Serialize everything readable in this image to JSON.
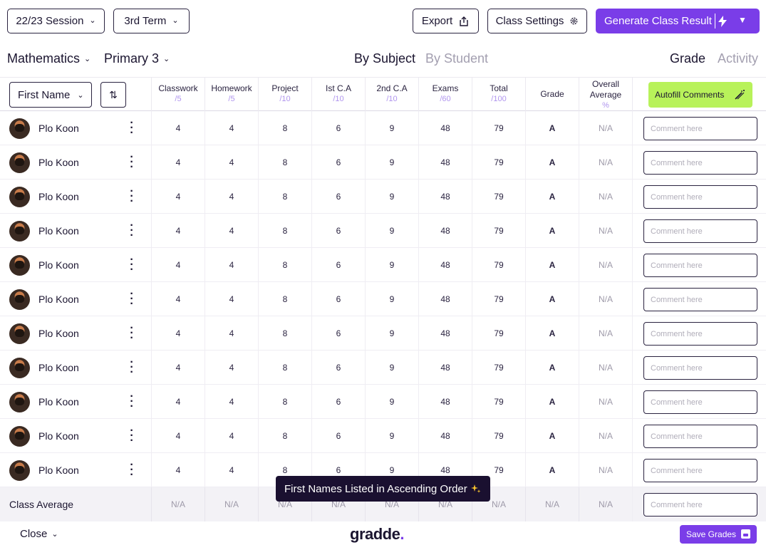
{
  "topbar": {
    "session": "22/23 Session",
    "term": "3rd Term",
    "export_label": "Export",
    "class_settings_label": "Class Settings",
    "generate_label": "Generate Class Result"
  },
  "subbar": {
    "subject": "Mathematics",
    "class": "Primary 3",
    "view_tabs": [
      "By Subject",
      "By Student"
    ],
    "active_view": "By Subject",
    "mode_tabs": [
      "Grade",
      "Activity"
    ],
    "active_mode": "Grade"
  },
  "table": {
    "sort_field": "First Name",
    "columns": [
      {
        "label": "Classwork",
        "max": "/5"
      },
      {
        "label": "Homework",
        "max": "/5"
      },
      {
        "label": "Project",
        "max": "/10"
      },
      {
        "label": "Ist C.A",
        "max": "/10"
      },
      {
        "label": "2nd C.A",
        "max": "/10"
      },
      {
        "label": "Exams",
        "max": "/60"
      },
      {
        "label": "Total",
        "max": "/100"
      },
      {
        "label": "Grade",
        "max": ""
      },
      {
        "label": "Overall Average",
        "max": "%"
      }
    ],
    "autofill_label": "Autofill Comments",
    "comment_placeholder": "Comment here",
    "rows": [
      {
        "name": "Plo Koon",
        "values": [
          "4",
          "4",
          "8",
          "6",
          "9",
          "48",
          "79",
          "A",
          "N/A"
        ]
      },
      {
        "name": "Plo Koon",
        "values": [
          "4",
          "4",
          "8",
          "6",
          "9",
          "48",
          "79",
          "A",
          "N/A"
        ]
      },
      {
        "name": "Plo Koon",
        "values": [
          "4",
          "4",
          "8",
          "6",
          "9",
          "48",
          "79",
          "A",
          "N/A"
        ]
      },
      {
        "name": "Plo Koon",
        "values": [
          "4",
          "4",
          "8",
          "6",
          "9",
          "48",
          "79",
          "A",
          "N/A"
        ]
      },
      {
        "name": "Plo Koon",
        "values": [
          "4",
          "4",
          "8",
          "6",
          "9",
          "48",
          "79",
          "A",
          "N/A"
        ]
      },
      {
        "name": "Plo Koon",
        "values": [
          "4",
          "4",
          "8",
          "6",
          "9",
          "48",
          "79",
          "A",
          "N/A"
        ]
      },
      {
        "name": "Plo Koon",
        "values": [
          "4",
          "4",
          "8",
          "6",
          "9",
          "48",
          "79",
          "A",
          "N/A"
        ]
      },
      {
        "name": "Plo Koon",
        "values": [
          "4",
          "4",
          "8",
          "6",
          "9",
          "48",
          "79",
          "A",
          "N/A"
        ]
      },
      {
        "name": "Plo Koon",
        "values": [
          "4",
          "4",
          "8",
          "6",
          "9",
          "48",
          "79",
          "A",
          "N/A"
        ]
      },
      {
        "name": "Plo Koon",
        "values": [
          "4",
          "4",
          "8",
          "6",
          "9",
          "48",
          "79",
          "A",
          "N/A"
        ]
      },
      {
        "name": "Plo Koon",
        "values": [
          "4",
          "4",
          "8",
          "6",
          "9",
          "48",
          "79",
          "A",
          "N/A"
        ]
      }
    ],
    "class_average": {
      "label": "Class Average",
      "values": [
        "N/A",
        "N/A",
        "N/A",
        "N/A",
        "N/A",
        "N/A",
        "N/A",
        "N/A",
        "N/A"
      ]
    }
  },
  "toast": "First Names Listed in Ascending Order",
  "footer": {
    "close_label": "Close",
    "logo_text": "gradde",
    "logo_dot": ".",
    "save_label": "Save Grades"
  },
  "colors": {
    "primary": "#7a3de8",
    "accent_lime": "#b8f25a",
    "dark": "#1b1530"
  }
}
